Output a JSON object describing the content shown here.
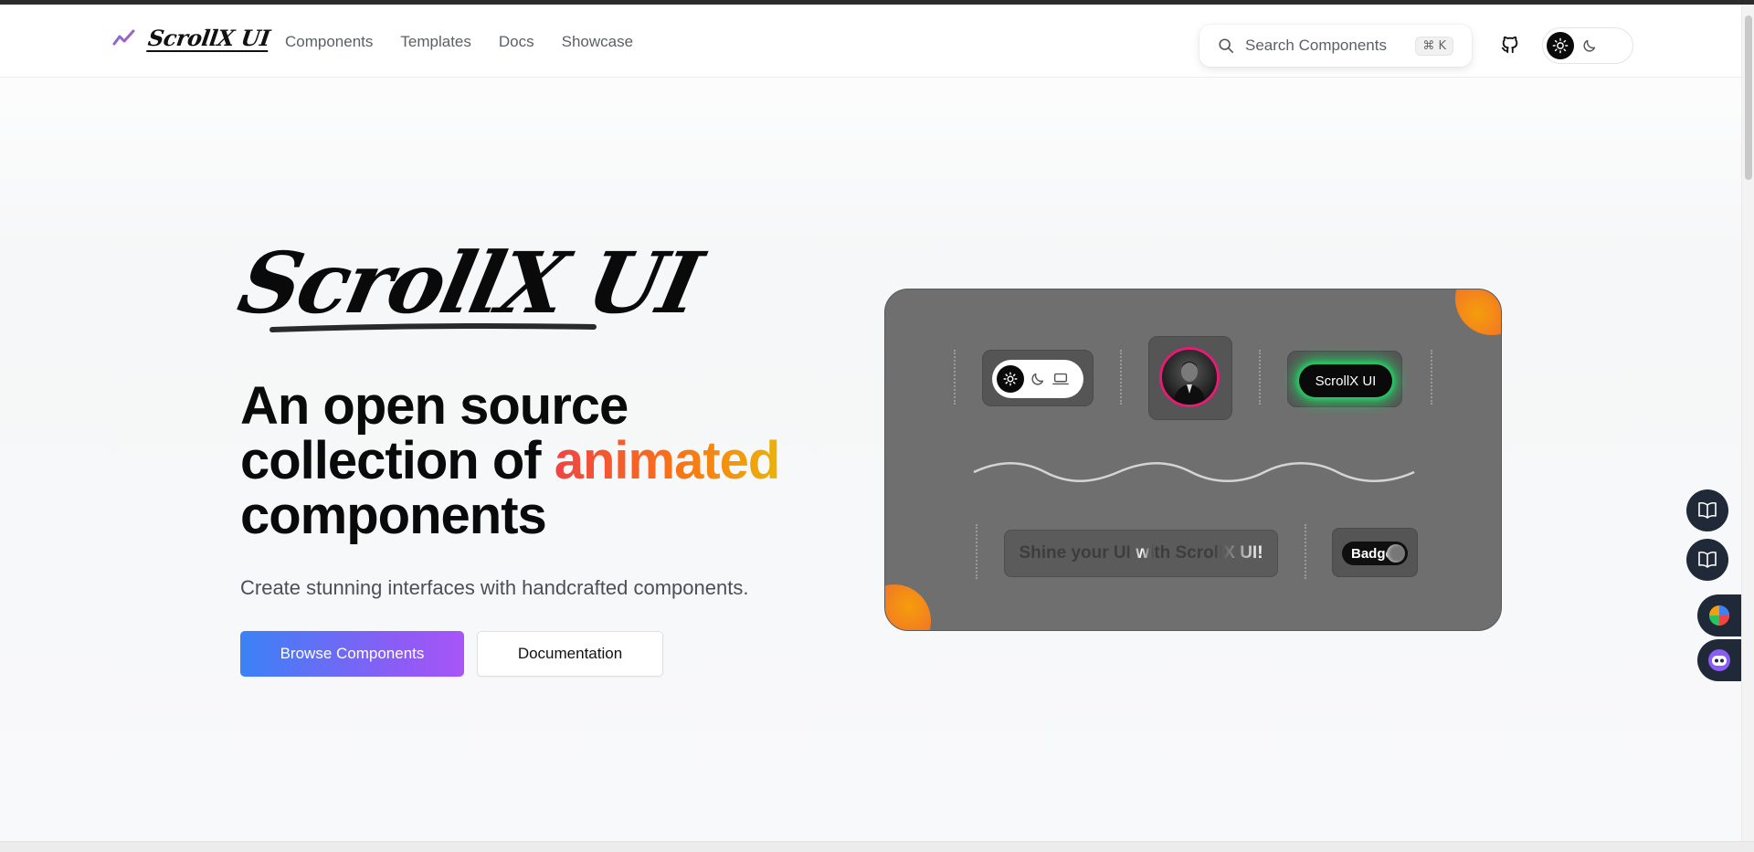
{
  "header": {
    "logo_text": "ScrollX UI",
    "nav": [
      "Components",
      "Templates",
      "Docs",
      "Showcase"
    ],
    "search": {
      "placeholder": "Search Components",
      "shortcut": "⌘ K"
    }
  },
  "hero": {
    "brand": "ScrollX UI",
    "headline_line1": "An open source",
    "headline_line2_prefix": "collection of",
    "headline_accent": "animated",
    "headline_line3": "components",
    "subtitle": "Create stunning interfaces with handcrafted components.",
    "primary_button": "Browse Components",
    "secondary_button": "Documentation"
  },
  "showcase": {
    "glow_button_label": "ScrollX UI",
    "shine_text": "Shine your UI with ScrollX UI!",
    "badge_label": "Badge"
  },
  "colors": {
    "accent_gradient": [
      "#ef4444",
      "#f97316",
      "#eab308"
    ],
    "primary_button_gradient": [
      "#3b82f6",
      "#a855f7"
    ],
    "glow": "#22c55e",
    "card_bg": "#6f6f6f"
  },
  "icons": {
    "search": "search-icon",
    "github": "github-icon",
    "sun": "sun-icon",
    "moon": "moon-icon",
    "laptop": "laptop-icon",
    "book": "book-icon"
  }
}
